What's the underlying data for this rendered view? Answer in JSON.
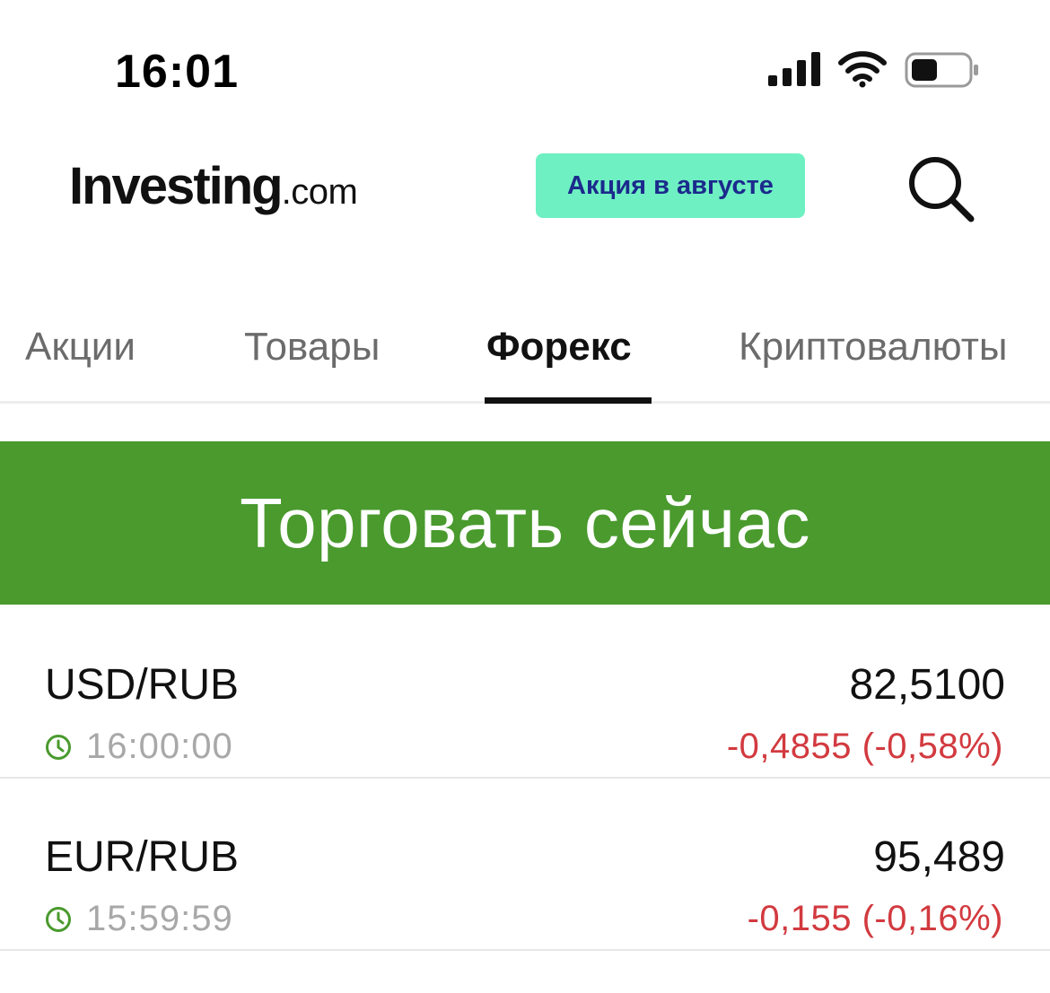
{
  "status_bar": {
    "time": "16:01",
    "signal_icon": "cellular-signal-icon",
    "wifi_icon": "wifi-icon",
    "battery_icon": "battery-icon"
  },
  "header": {
    "logo_main": "Investing",
    "logo_suffix": ".com",
    "promo_label": "Акция в августе",
    "promo_bg": "#6ef0c2",
    "promo_text_color": "#1b2a8c",
    "search_icon": "search-icon"
  },
  "tabs": [
    {
      "label": "Акции",
      "active": false
    },
    {
      "label": "Товары",
      "active": false
    },
    {
      "label": "Форекс",
      "active": true
    },
    {
      "label": "Криптовалюты",
      "active": false
    }
  ],
  "cta": {
    "label": "Торговать сейчас",
    "bg": "#4a9a2e"
  },
  "quotes": [
    {
      "pair": "USD/RUB",
      "time": "16:00:00",
      "price": "82,5100",
      "change": "-0,4855 (-0,58%)"
    },
    {
      "pair": "EUR/RUB",
      "time": "15:59:59",
      "price": "95,489",
      "change": "-0,155 (-0,16%)"
    }
  ],
  "colors": {
    "negative": "#d23a3f",
    "clock_green": "#4a9a2e"
  }
}
